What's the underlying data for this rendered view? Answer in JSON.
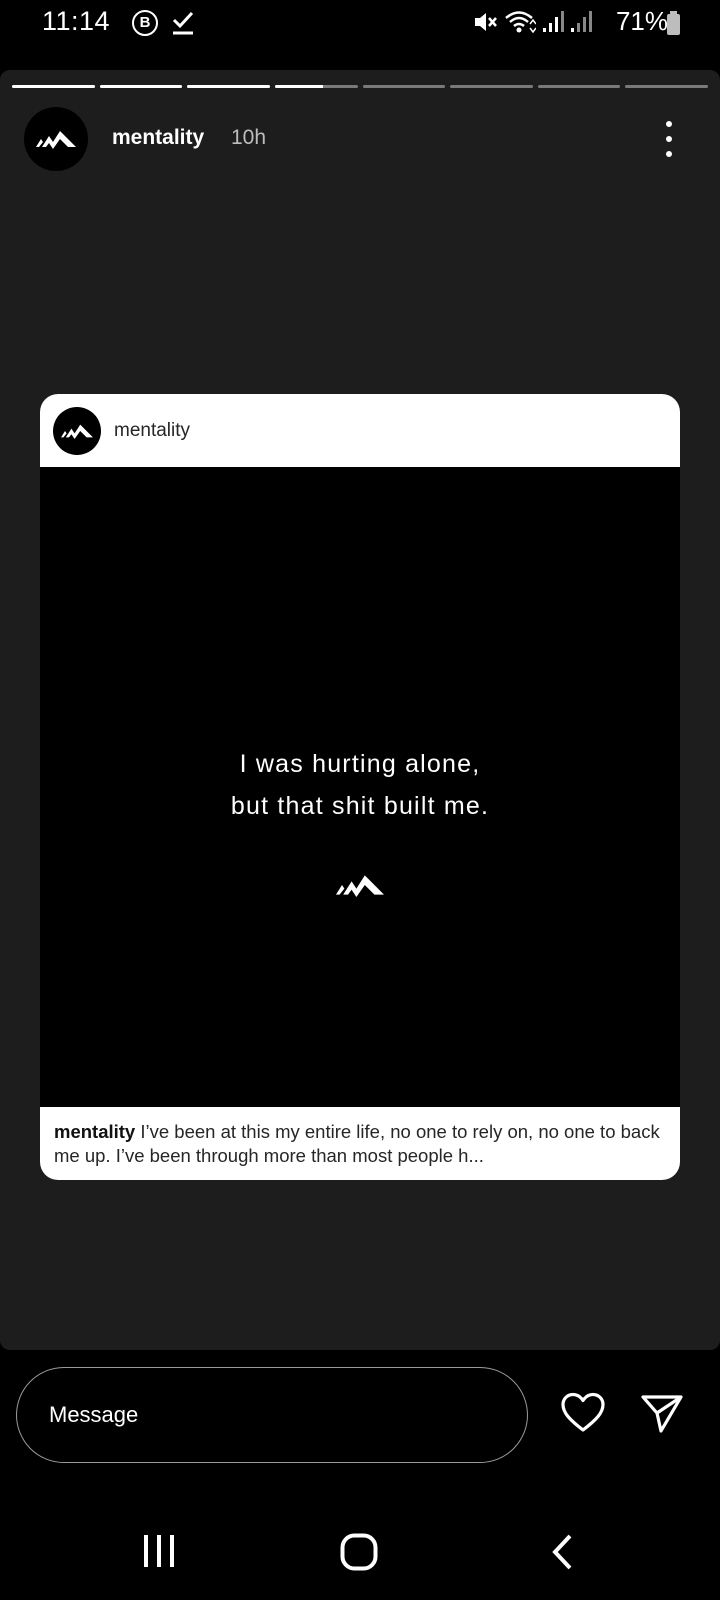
{
  "status_bar": {
    "time": "11:14",
    "notif_icon_letter": "B",
    "battery": "71%"
  },
  "story": {
    "segments_total": 8,
    "segments_complete": 3,
    "current_segment_progress": 0.58,
    "username": "mentality",
    "time_ago": "10h"
  },
  "post": {
    "username": "mentality",
    "quote_line1": "I was hurting alone,",
    "quote_line2": "but that shit built me.",
    "caption_user": "mentality",
    "caption_text": "I’ve been at this my entire life, no one to rely on, no one to back me up. I’ve been through more than most people h..."
  },
  "reply": {
    "placeholder": "Message"
  },
  "icons": {
    "logo": "mentality-logo-icon",
    "like": "heart-icon",
    "share": "send-icon",
    "more": "more-vertical-icon"
  }
}
